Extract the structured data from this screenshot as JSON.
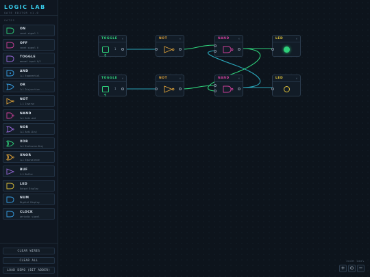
{
  "brand": {
    "title": "LOGIC LAB",
    "subtitle": "GATE EDITOR v1.0"
  },
  "sidebar": {
    "section_label": "GATES",
    "items": [
      {
        "name": "ON",
        "desc": "const signal 1",
        "color": "#2fd07a"
      },
      {
        "name": "OFF",
        "desc": "const signal 0",
        "color": "#d0419c"
      },
      {
        "name": "TOGGLE",
        "desc": "manual input 0/1",
        "color": "#9b6bde"
      },
      {
        "name": "AND",
        "desc": "1+1 Exponential",
        "color": "#38a0e6"
      },
      {
        "name": "OR",
        "desc": "1+1 Disjunction",
        "color": "#38a0e6"
      },
      {
        "name": "NOT",
        "desc": "1-1 Inverse",
        "color": "#e0a33a"
      },
      {
        "name": "NAND",
        "desc": "1+1 Anti-and",
        "color": "#d0419c"
      },
      {
        "name": "NOR",
        "desc": "1+1 Anti-Disj",
        "color": "#9b6bde"
      },
      {
        "name": "XOR",
        "desc": "1+1 Exclusive-Disj",
        "color": "#2fd07a"
      },
      {
        "name": "XNOR",
        "desc": "1+1 Equivalence",
        "color": "#e0a33a"
      },
      {
        "name": "BUF",
        "desc": "1-1 Buffer",
        "color": "#9b6bde"
      },
      {
        "name": "LED",
        "desc": "Output Display",
        "color": "#e0c23a"
      },
      {
        "name": "NUM",
        "desc": "Digital Display",
        "color": "#38a0e6"
      },
      {
        "name": "CLOCK",
        "desc": "periodic signal",
        "color": "#38a0e6"
      }
    ],
    "buttons": {
      "clear_wires": "CLEAR WIRES",
      "clear_all": "CLEAR ALL",
      "load_demo": "LOAD DEMO (BIT ADDER)"
    }
  },
  "nodes": {
    "toggle_top": {
      "label": "TOGGLE",
      "value": "1",
      "close": "×"
    },
    "not_top": {
      "label": "NOT",
      "close": "×"
    },
    "nand_top": {
      "label": "NAND",
      "close": "×"
    },
    "led_top": {
      "label": "LED",
      "close": "×"
    },
    "toggle_bottom": {
      "label": "TOGGLE",
      "value": "1",
      "close": "×"
    },
    "not_bottom": {
      "label": "NOT",
      "close": "×"
    },
    "nand_bottom": {
      "label": "NAND",
      "close": "×"
    },
    "led_bottom": {
      "label": "LED",
      "close": "×"
    }
  },
  "zoom": {
    "label": "ZOOM 100%",
    "plus": "+",
    "reset": "⊙",
    "minus": "−"
  },
  "colors": {
    "accent": "#37c8e6",
    "wire_active": "#2fd07a",
    "wire_idle": "#2aa5b8",
    "toggle": "#2fd07a",
    "not": "#e0a33a",
    "nand": "#d0419c",
    "led": "#e0c23a"
  }
}
